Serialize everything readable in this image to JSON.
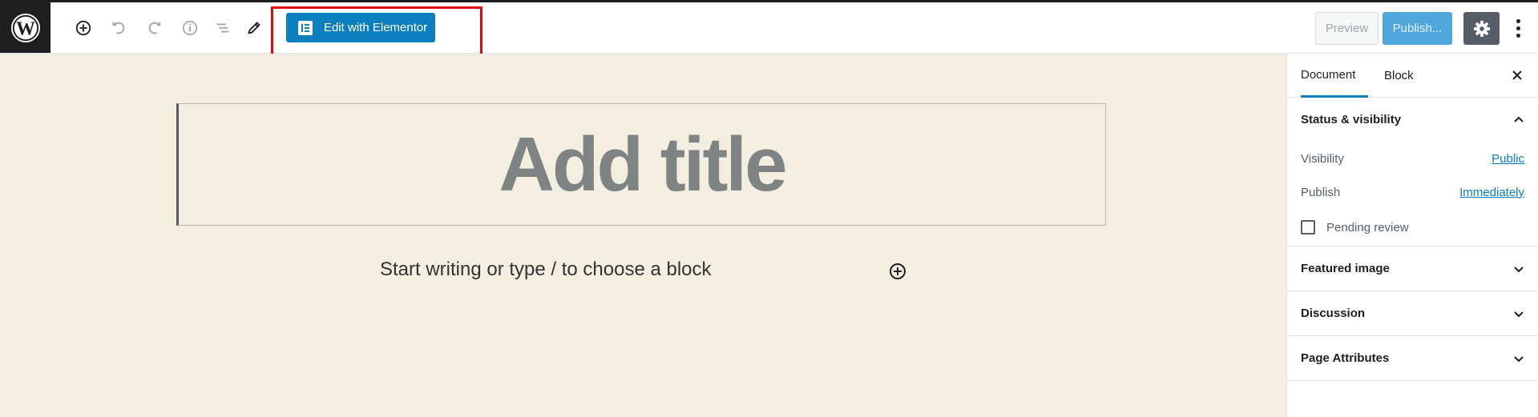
{
  "header": {
    "edit_elementor_label": "Edit with Elementor",
    "preview_label": "Preview",
    "publish_label": "Publish..."
  },
  "editor": {
    "title_placeholder": "Add title",
    "paragraph_placeholder": "Start writing or type / to choose a block"
  },
  "sidebar": {
    "tabs": [
      {
        "label": "Document"
      },
      {
        "label": "Block"
      }
    ],
    "status_visibility": {
      "title": "Status & visibility",
      "visibility_label": "Visibility",
      "visibility_value": "Public",
      "publish_label": "Publish",
      "publish_value": "Immediately",
      "pending_label": "Pending review"
    },
    "panels": [
      {
        "title": "Featured image"
      },
      {
        "title": "Discussion"
      },
      {
        "title": "Page Attributes"
      }
    ]
  },
  "colors": {
    "accent": "#0b7ebe",
    "editor_bg": "#f3eedf",
    "highlight": "#e3080c"
  }
}
